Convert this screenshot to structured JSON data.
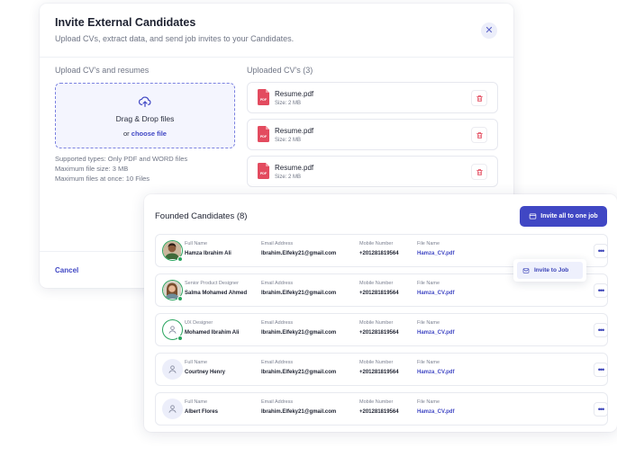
{
  "modal": {
    "title": "Invite External Candidates",
    "subtitle": "Upload CVs, extract data, and send job invites to your Candidates.",
    "upload_label": "Upload CV's and resumes",
    "dropzone": {
      "main_text": "Drag & Drop files",
      "or_text": "or",
      "choose_link": "choose file"
    },
    "notes": [
      "Supported types: Only PDF and WORD files",
      "Maximum file size: 3 MB",
      "Maximum files at once: 10 Files"
    ],
    "uploaded_label": "Uploaded CV's (3)",
    "files": [
      {
        "name": "Resume.pdf",
        "size": "Size: 2 MB",
        "icon": "pdf-icon"
      },
      {
        "name": "Resume.pdf",
        "size": "Size: 2 MB",
        "icon": "pdf-icon"
      },
      {
        "name": "Resume.pdf",
        "size": "Size: 2 MB",
        "icon": "pdf-icon"
      }
    ],
    "cancel_label": "Cancel"
  },
  "candidates_panel": {
    "title": "Founded Candidates (8)",
    "invite_all_label": "Invite all to one job",
    "rows": [
      {
        "role": "Full Name",
        "name": "Hamza Ibrahim Ali",
        "email_label": "Email Address",
        "email": "Ibrahim.Elfeky21@gmail.com",
        "mobile_label": "Mobile Number",
        "mobile": "+201281819564",
        "file_label": "File Name",
        "file": "Hamza_CV.pdf",
        "avatar": "photo"
      },
      {
        "role": "Senior Product Designer",
        "name": "Salma Mohamed Ahmed",
        "email_label": "Email Address",
        "email": "Ibrahim.Elfeky21@gmail.com",
        "mobile_label": "Mobile Number",
        "mobile": "+201281819564",
        "file_label": "File Name",
        "file": "Hamza_CV.pdf",
        "avatar": "photo"
      },
      {
        "role": "UX Designer",
        "name": "Mohamed Ibrahim Ali",
        "email_label": "Email Address",
        "email": "Ibrahim.Elfeky21@gmail.com",
        "mobile_label": "Mobile Number",
        "mobile": "+201281819564",
        "file_label": "File Name",
        "file": "Hamza_CV.pdf",
        "avatar": "placeholder"
      },
      {
        "role": "Full Name",
        "name": "Courtney Henry",
        "email_label": "Email Address",
        "email": "Ibrahim.Elfeky21@gmail.com",
        "mobile_label": "Mobile Number",
        "mobile": "+201281819564",
        "file_label": "File Name",
        "file": "Hamza_CV.pdf",
        "avatar": "placeholder"
      },
      {
        "role": "Full Name",
        "name": "Albert Flores",
        "email_label": "Email Address",
        "email": "Ibrahim.Elfeky21@gmail.com",
        "mobile_label": "Mobile Number",
        "mobile": "+201281819564",
        "file_label": "File Name",
        "file": "Hamza_CV.pdf",
        "avatar": "placeholder"
      }
    ],
    "dropdown": {
      "item_label": "Invite to Job"
    }
  },
  "colors": {
    "accent": "#4047c4",
    "success": "#2aa55f",
    "danger": "#e34b5f",
    "dropzone_bg": "#f4f5fe"
  }
}
